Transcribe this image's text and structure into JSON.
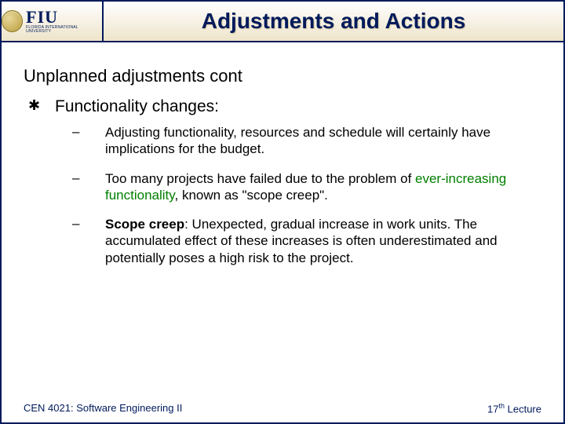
{
  "header": {
    "logo_main": "FIU",
    "logo_sub": "FLORIDA INTERNATIONAL UNIVERSITY",
    "title": "Adjustments and Actions"
  },
  "content": {
    "section_heading": "Unplanned adjustments cont",
    "bullet_label": "Functionality changes:",
    "sub_items": {
      "a": "Adjusting functionality, resources and schedule will certainly have implications for the budget.",
      "b_pre": "Too many projects have failed due to the problem of ",
      "b_green": "ever-increasing functionality",
      "b_post": ", known as \"scope creep\".",
      "c_bold": "Scope creep",
      "c_rest": ": Unexpected, gradual increase in work units. The accumulated effect of these increases is often underestimated and potentially poses a high risk to the project."
    }
  },
  "footer": {
    "left": "CEN 4021: Software Engineering II",
    "right_num": "17",
    "right_sup": "th",
    "right_rest": " Lecture"
  }
}
